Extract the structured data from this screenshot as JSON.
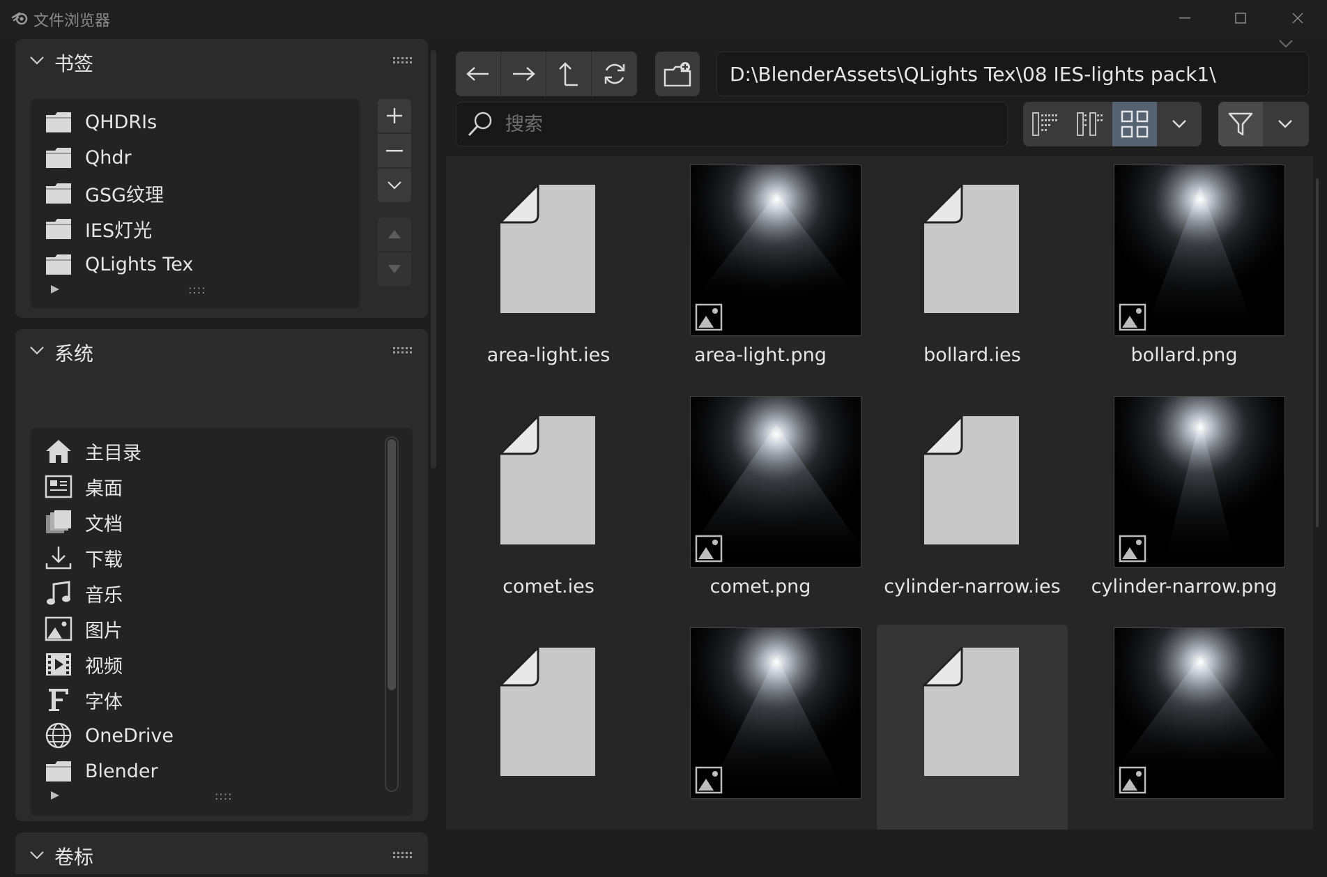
{
  "window": {
    "title": "文件浏览器"
  },
  "bookmarks": {
    "title": "书签",
    "items": [
      {
        "label": "QHDRIs",
        "icon": "folder-icon"
      },
      {
        "label": "Qhdr",
        "icon": "folder-icon"
      },
      {
        "label": "GSG纹理",
        "icon": "folder-icon"
      },
      {
        "label": "IES灯光",
        "icon": "folder-icon"
      },
      {
        "label": "QLights Tex",
        "icon": "folder-icon"
      }
    ],
    "grip": "::::"
  },
  "system": {
    "title": "系统",
    "items": [
      {
        "label": "主目录",
        "icon": "home-icon"
      },
      {
        "label": "桌面",
        "icon": "desktop-icon"
      },
      {
        "label": "文档",
        "icon": "documents-icon"
      },
      {
        "label": "下载",
        "icon": "download-icon"
      },
      {
        "label": "音乐",
        "icon": "music-icon"
      },
      {
        "label": "图片",
        "icon": "image-icon"
      },
      {
        "label": "视频",
        "icon": "film-icon"
      },
      {
        "label": "字体",
        "icon": "font-icon"
      },
      {
        "label": "OneDrive",
        "icon": "globe-icon"
      },
      {
        "label": "Blender",
        "icon": "folder-icon"
      }
    ],
    "grip": "::::"
  },
  "volumes": {
    "title": "卷标"
  },
  "toolbar": {
    "path": "D:\\BlenderAssets\\QLights Tex\\08 IES-lights pack1\\",
    "search_placeholder": "搜索"
  },
  "files": [
    {
      "name": "area-light.ies",
      "type": "file"
    },
    {
      "name": "area-light.png",
      "type": "image",
      "shape": "area"
    },
    {
      "name": "bollard.ies",
      "type": "file"
    },
    {
      "name": "bollard.png",
      "type": "image",
      "shape": "bollard"
    },
    {
      "name": "comet.ies",
      "type": "file"
    },
    {
      "name": "comet.png",
      "type": "image",
      "shape": "comet"
    },
    {
      "name": "cylinder-narrow.ies",
      "type": "file"
    },
    {
      "name": "cylinder-narrow.png",
      "type": "image",
      "shape": "narrow"
    },
    {
      "name": "",
      "type": "file"
    },
    {
      "name": "",
      "type": "image",
      "shape": "spot"
    },
    {
      "name": "",
      "type": "file",
      "selected": true
    },
    {
      "name": "",
      "type": "image",
      "shape": "wide"
    }
  ],
  "colors": {
    "accent_active": "#546272",
    "panel_bg": "#2b2b2b",
    "list_bg": "#232323",
    "window_bg": "#1d1d1d"
  }
}
